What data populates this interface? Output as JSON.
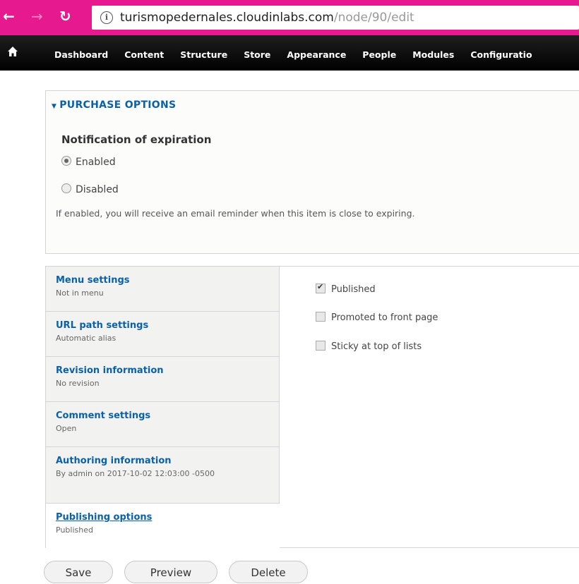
{
  "browser": {
    "url_host": "turismopedernales.cloudinlabs.com",
    "url_path": "/node/90/edit"
  },
  "toolbar": {
    "items": [
      "Dashboard",
      "Content",
      "Structure",
      "Store",
      "Appearance",
      "People",
      "Modules",
      "Configuratio"
    ]
  },
  "purchase": {
    "legend": "PURCHASE OPTIONS",
    "title": "Notification of expiration",
    "options": [
      {
        "label": "Enabled",
        "checked": true
      },
      {
        "label": "Disabled",
        "checked": false
      }
    ],
    "description": "If enabled, you will receive an email reminder when this item is close to expiring."
  },
  "tabs": [
    {
      "title": "Menu settings",
      "summary": "Not in menu"
    },
    {
      "title": "URL path settings",
      "summary": "Automatic alias"
    },
    {
      "title": "Revision information",
      "summary": "No revision"
    },
    {
      "title": "Comment settings",
      "summary": "Open"
    },
    {
      "title": "Authoring information",
      "summary": "By admin on 2017-10-02 12:03:00 -0500"
    },
    {
      "title": "Publishing options",
      "summary": "Published",
      "active": true
    }
  ],
  "publishing": [
    {
      "label": "Published",
      "checked": true
    },
    {
      "label": "Promoted to front page",
      "checked": false
    },
    {
      "label": "Sticky at top of lists",
      "checked": false
    }
  ],
  "actions": {
    "save": "Save",
    "preview": "Preview",
    "delete": "Delete"
  }
}
